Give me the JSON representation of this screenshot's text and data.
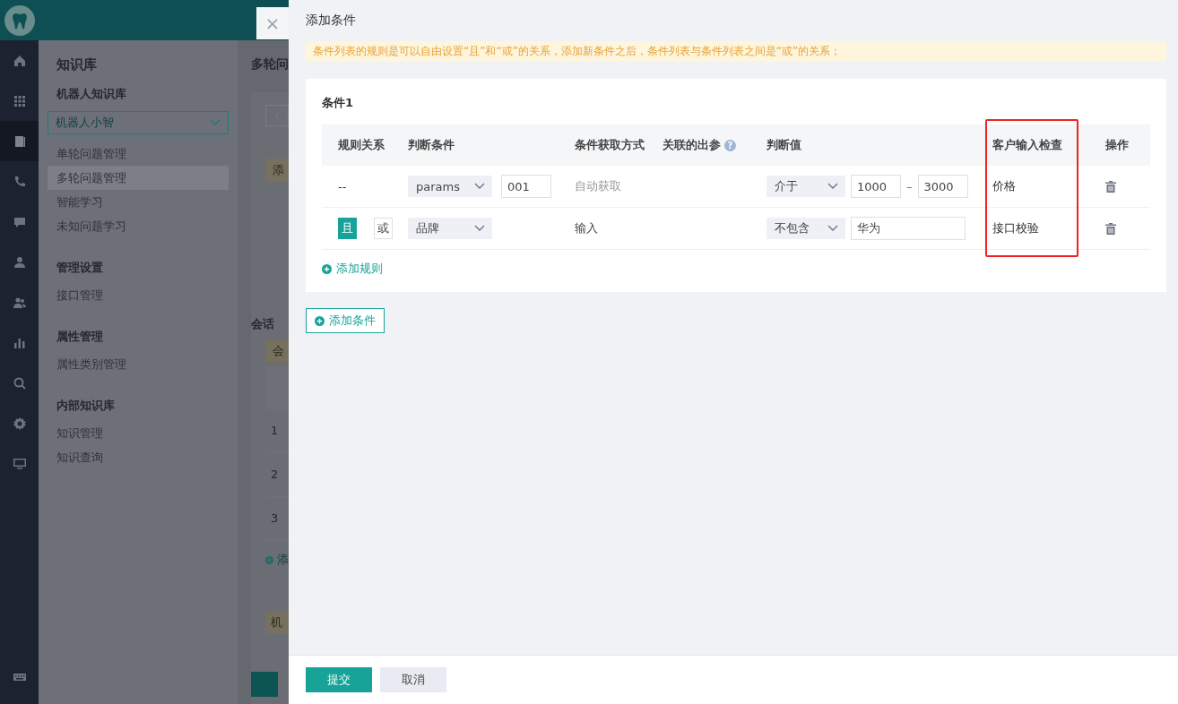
{
  "rail": {
    "items": [
      {
        "selected": false
      },
      {
        "selected": false
      },
      {
        "selected": true
      },
      {
        "selected": false
      },
      {
        "selected": false
      },
      {
        "selected": false
      },
      {
        "selected": false
      },
      {
        "selected": false
      },
      {
        "selected": false
      },
      {
        "selected": false
      },
      {
        "selected": false
      }
    ]
  },
  "sidebar": {
    "title": "知识库",
    "groups": [
      {
        "title": "机器人知识库",
        "dropdown": "机器人小智",
        "items": [
          {
            "label": "单轮问题管理",
            "selected": false
          },
          {
            "label": "多轮问题管理",
            "selected": true
          },
          {
            "label": "智能学习",
            "selected": false
          },
          {
            "label": "未知问题学习",
            "selected": false
          }
        ]
      },
      {
        "title": "管理设置",
        "items": [
          {
            "label": "接口管理",
            "selected": false
          }
        ]
      },
      {
        "title": "属性管理",
        "items": [
          {
            "label": "属性类别管理",
            "selected": false
          }
        ]
      },
      {
        "title": "内部知识库",
        "items": [
          {
            "label": "知识管理",
            "selected": false
          },
          {
            "label": "知识查询",
            "selected": false
          }
        ]
      }
    ]
  },
  "background_page": {
    "title": "多轮问",
    "notice": "添",
    "section": "会话",
    "section_notice": "会",
    "rows": [
      "1",
      "2",
      "3"
    ],
    "add_link": "添",
    "field_value": "机"
  },
  "drawer": {
    "title": "添加条件",
    "close": "×",
    "notice": "条件列表的规则是可以自由设置“且”和“或”的关系，添加新条件之后，条件列表与条件列表之间是“或”的关系；",
    "conditions": [
      {
        "title": "条件1",
        "help_mark": "?",
        "columns": [
          "规则关系",
          "判断条件",
          "条件获取方式",
          "关联的出参",
          "判断值",
          "客户输入检查",
          "操作"
        ],
        "rows": [
          {
            "relation": {
              "kind": "text",
              "text": "--"
            },
            "condition": "params",
            "param": "001",
            "method": "自动获取",
            "method_muted": true,
            "operator": "介于",
            "values": [
              "1000",
              "3000"
            ],
            "range_sep": "–",
            "check": "价格"
          },
          {
            "relation": {
              "kind": "toggle",
              "options": [
                {
                  "label": "且",
                  "selected": true
                },
                {
                  "label": "或",
                  "selected": false
                }
              ]
            },
            "condition": "品牌",
            "method": "输入",
            "method_muted": false,
            "operator": "不包含",
            "values": [
              "华为"
            ],
            "check": "接口校验"
          }
        ],
        "add_rule": "添加规则"
      }
    ],
    "add_condition": "添加条件",
    "buttons": [
      {
        "label": "提交",
        "kind": "primary"
      },
      {
        "label": "取消",
        "kind": "secondary"
      }
    ]
  }
}
